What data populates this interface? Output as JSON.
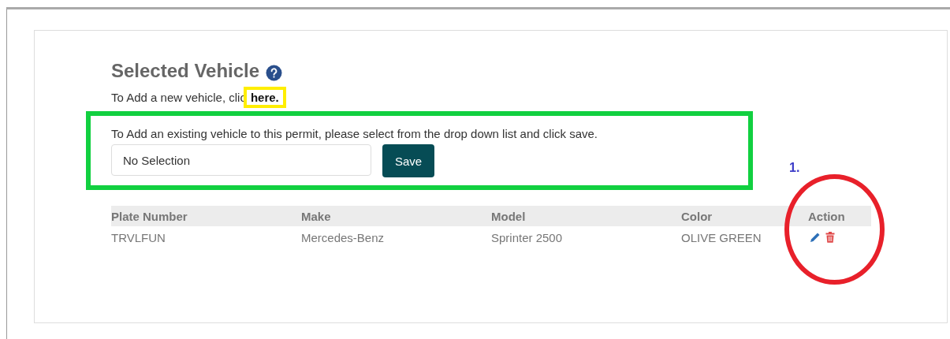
{
  "heading": "Selected Vehicle",
  "add_new": {
    "text": "To Add a new vehicle, clic",
    "link": "here."
  },
  "existing": {
    "text": "To Add an existing vehicle to this permit, please select from the drop down list and click save.",
    "select_value": "No Selection",
    "button": "Save"
  },
  "table": {
    "columns": [
      "Plate Number",
      "Make",
      "Model",
      "Color",
      "Action"
    ],
    "rows": [
      {
        "cells": [
          "TRVLFUN",
          "Mercedes-Benz",
          "Sprinter 2500",
          "OLIVE GREEN"
        ]
      }
    ]
  },
  "annotation_label": "1."
}
